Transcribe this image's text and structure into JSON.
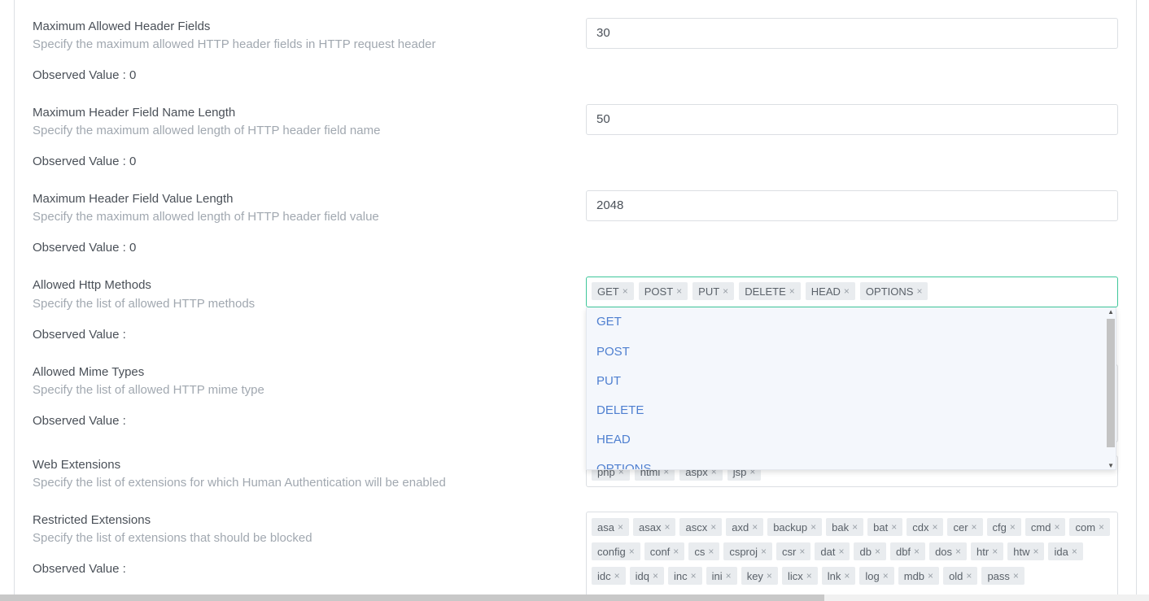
{
  "fields": [
    {
      "label": "Maximum Allowed Header Fields",
      "desc": "Specify the maximum allowed HTTP header fields in HTTP request header",
      "observed": "Observed Value : 0",
      "value": "30"
    },
    {
      "label": "Maximum Header Field Name Length",
      "desc": "Specify the maximum allowed length of HTTP header field name",
      "observed": "Observed Value : 0",
      "value": "50"
    },
    {
      "label": "Maximum Header Field Value Length",
      "desc": "Specify the maximum allowed length of HTTP header field value",
      "observed": "Observed Value : 0",
      "value": "2048"
    }
  ],
  "http_methods": {
    "label": "Allowed Http Methods",
    "desc": "Specify the list of allowed HTTP methods",
    "observed": "Observed Value :",
    "tags": [
      "GET",
      "POST",
      "PUT",
      "DELETE",
      "HEAD",
      "OPTIONS"
    ],
    "dropdown_options": [
      "GET",
      "POST",
      "PUT",
      "DELETE",
      "HEAD",
      "OPTIONS"
    ]
  },
  "mime_types": {
    "label": "Allowed Mime Types",
    "desc": "Specify the list of allowed HTTP mime type",
    "observed": "Observed Value :"
  },
  "web_extensions": {
    "label": "Web Extensions",
    "desc": "Specify the list of extensions for which Human Authentication will be enabled",
    "tags": [
      "php",
      "html",
      "aspx",
      "jsp"
    ]
  },
  "restricted_extensions": {
    "label": "Restricted Extensions",
    "desc": "Specify the list of extensions that should be blocked",
    "observed": "Observed Value :",
    "tags": [
      "asa",
      "asax",
      "ascx",
      "axd",
      "backup",
      "bak",
      "bat",
      "cdx",
      "cer",
      "cfg",
      "cmd",
      "com",
      "config",
      "conf",
      "cs",
      "csproj",
      "csr",
      "dat",
      "db",
      "dbf",
      "dos",
      "htr",
      "htw",
      "ida",
      "idc",
      "idq",
      "inc",
      "ini",
      "key",
      "licx",
      "lnk",
      "log",
      "mdb",
      "old",
      "pass"
    ]
  },
  "tag_remove_glyph": "×",
  "colors": {
    "focus_border": "#3ec79a",
    "option_text": "#4e7fd0",
    "dropdown_bg": "#f4f7fc"
  }
}
